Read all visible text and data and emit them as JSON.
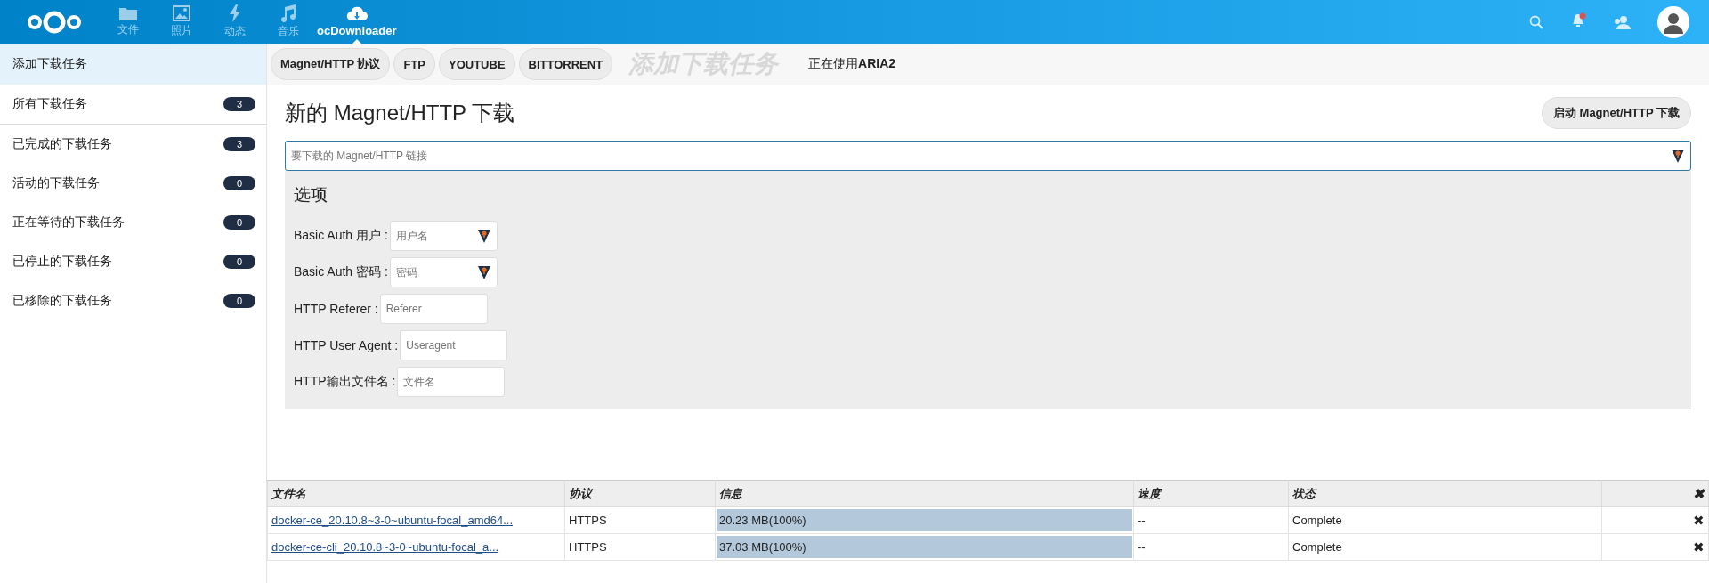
{
  "header": {
    "apps": [
      {
        "kind": "folder",
        "label": "文件",
        "selected": false
      },
      {
        "kind": "image",
        "label": "照片",
        "selected": false
      },
      {
        "kind": "bolt",
        "label": "动态",
        "selected": false
      },
      {
        "kind": "music",
        "label": "音乐",
        "selected": false
      },
      {
        "kind": "cloud",
        "label": "ocDownloader",
        "selected": true
      }
    ],
    "notification_unread": true
  },
  "sidebar": {
    "items": [
      {
        "label": "添加下载任务",
        "selected": true
      },
      {
        "label": "所有下载任务",
        "count": "3",
        "selected": false
      },
      {
        "label": "已完成的下载任务",
        "count": "3",
        "selected": false
      },
      {
        "label": "活动的下载任务",
        "count": "0",
        "selected": false
      },
      {
        "label": "正在等待的下载任务",
        "count": "0",
        "selected": false
      },
      {
        "label": "已停止的下载任务",
        "count": "0",
        "selected": false
      },
      {
        "label": "已移除的下载任务",
        "count": "0",
        "selected": false
      }
    ]
  },
  "tabs": [
    "Magnet/HTTP 协议",
    "FTP",
    "YOUTUBE",
    "BITTORRENT"
  ],
  "section_title": "添加下载任务",
  "engine_status": "正在使用**ARIA2**",
  "form": {
    "title": "新的 Magnet/HTTP 下载",
    "start_button": "启动 Magnet/HTTP 下载",
    "url_placeholder": "要下载的 Magnet/HTTP 链接",
    "url_key_icon": true,
    "options_title": "选项",
    "options": [
      {
        "label": "Basic Auth 用户 :",
        "placeholder": "用户名",
        "key_icon": true
      },
      {
        "label": "Basic Auth 密码 :",
        "placeholder": "密码",
        "key_icon": true
      },
      {
        "label": "HTTP Referer :",
        "placeholder": "Referer",
        "key_icon": false
      },
      {
        "label": "HTTP User Agent :",
        "placeholder": "Useragent",
        "key_icon": false
      },
      {
        "label": "HTTP输出文件名 :",
        "placeholder": "文件名",
        "key_icon": false
      }
    ]
  },
  "table": {
    "columns": [
      "文件名",
      "协议",
      "信息",
      "速度",
      "状态"
    ],
    "clear_all": "✖",
    "rows": [
      {
        "file": "docker-ce_20.10.8~3-0~ubuntu-focal_amd64...",
        "protocol": "HTTPS",
        "info": "20.23 MB(100%)",
        "level": 1,
        "speed": "--",
        "status": "Complete",
        "remove": "✖"
      },
      {
        "file": "docker-ce-cli_20.10.8~3-0~ubuntu-focal_a...",
        "protocol": "HTTPS",
        "info": "37.03 MB(100%)",
        "level": 1,
        "speed": "--",
        "status": "Complete",
        "remove": "✖"
      }
    ]
  }
}
